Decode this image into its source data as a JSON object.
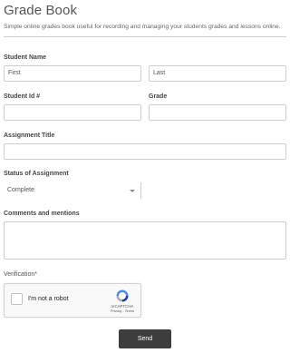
{
  "form": {
    "title": "Grade Book",
    "description": "Simple online grades book useful for recording and managing your students grades and lessons online.",
    "student_name": {
      "label": "Student Name",
      "first_placeholder": "First",
      "last_placeholder": "Last"
    },
    "student_id": {
      "label": "Student Id #",
      "value": ""
    },
    "grade": {
      "label": "Grade",
      "value": ""
    },
    "assignment_title": {
      "label": "Assignment Title",
      "value": ""
    },
    "status": {
      "label": "Status of Assignment",
      "selected": "Complete"
    },
    "comments": {
      "label": "Comments and mentions",
      "value": ""
    },
    "verification": {
      "label": "Verification",
      "required_mark": "*"
    },
    "send_label": "Send"
  },
  "captcha": {
    "label": "I'm not a robot",
    "brand": "reCAPTCHA",
    "links": "Privacy - Terms",
    "icon": "recaptcha-logo-icon"
  }
}
